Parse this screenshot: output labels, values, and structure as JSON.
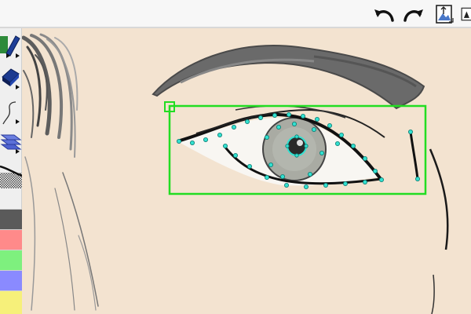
{
  "toolbar": {
    "items": [
      {
        "name": "undo-button",
        "icon": "undo-arrow-icon"
      },
      {
        "name": "redo-button",
        "icon": "redo-arrow-icon"
      },
      {
        "name": "image-layer-button",
        "icon": "image-transform-icon"
      },
      {
        "name": "triangle-menu-button",
        "icon": "triangle-icon"
      }
    ]
  },
  "tools": [
    {
      "name": "pen-tool",
      "icon": "pen-icon"
    },
    {
      "name": "eraser-tool",
      "icon": "eraser-icon"
    },
    {
      "name": "stroke-style-tool",
      "icon": "curve-stroke-icon"
    },
    {
      "name": "layers-tool",
      "icon": "layers-icon"
    },
    {
      "name": "texture-tool",
      "icon": "hatch-texture-icon"
    }
  ],
  "palette": {
    "colors": [
      "#5a5a5a",
      "#ff8a8a",
      "#7ef07e",
      "#8a8aff",
      "#f6f07a"
    ]
  },
  "canvas": {
    "background": "#f3e3d0",
    "selection_color": "#22dd22",
    "control_point_color": "#33e0d0"
  }
}
